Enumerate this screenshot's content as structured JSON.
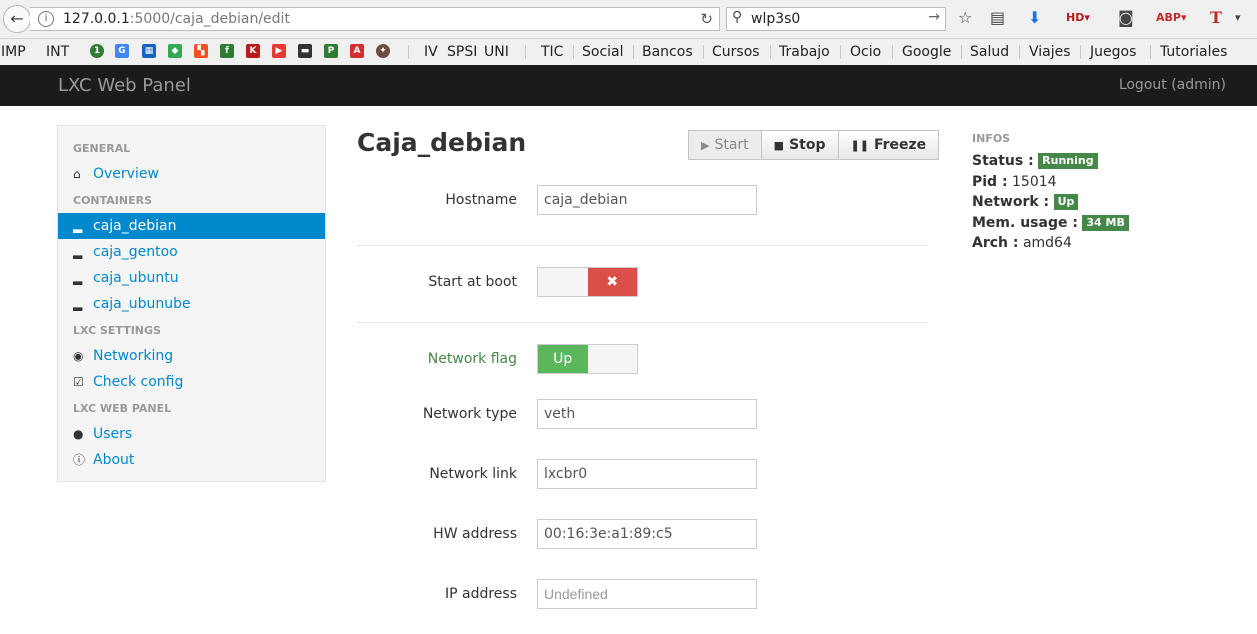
{
  "browser": {
    "url_host": "127.0.0.1",
    "url_path": ":5000/caja_debian/edit",
    "search_value": "wlp3s0",
    "bookmarks_left": [
      "IMP",
      "INT"
    ],
    "bookmarks_mid": [
      "IV",
      "SPSI",
      "UNI"
    ],
    "bookmarks_right": [
      "TIC",
      "Social",
      "Bancos",
      "Cursos",
      "Trabajo",
      "Ocio",
      "Google",
      "Salud",
      "Viajes",
      "Juegos",
      "Tutoriales"
    ]
  },
  "navbar": {
    "brand": "LXC Web Panel",
    "logout": "Logout (admin)"
  },
  "sidebar": {
    "general_header": "GENERAL",
    "overview": "Overview",
    "containers_header": "CONTAINERS",
    "containers": [
      "caja_debian",
      "caja_gentoo",
      "caja_ubuntu",
      "caja_ubunube"
    ],
    "lxc_settings_header": "LXC SETTINGS",
    "networking": "Networking",
    "check_config": "Check config",
    "lxc_web_panel_header": "LXC WEB PANEL",
    "users": "Users",
    "about": "About"
  },
  "main": {
    "title": "Caja_debian",
    "buttons": {
      "start": "Start",
      "stop": "Stop",
      "freeze": "Freeze"
    },
    "hostname_label": "Hostname",
    "hostname_value": "caja_debian",
    "start_at_boot_label": "Start at boot",
    "start_at_boot_off_symbol": "✖",
    "network_flag_label": "Network flag",
    "network_flag_value": "Up",
    "network_type_label": "Network type",
    "network_type_value": "veth",
    "network_link_label": "Network link",
    "network_link_value": "lxcbr0",
    "hw_address_label": "HW address",
    "hw_address_value": "00:16:3e:a1:89:c5",
    "ip_address_label": "IP address",
    "ip_address_placeholder": "Undefined"
  },
  "infos": {
    "header": "INFOS",
    "status_label": "Status :",
    "status_value": "Running",
    "pid_label": "Pid :",
    "pid_value": "15014",
    "network_label": "Network :",
    "network_value": "Up",
    "mem_label": "Mem. usage :",
    "mem_value": "34 MB",
    "arch_label": "Arch :",
    "arch_value": "amd64"
  },
  "colors": {
    "navbar": "#1b1b1b",
    "link": "#0088cc",
    "success": "#468847",
    "danger": "#da4f49"
  }
}
